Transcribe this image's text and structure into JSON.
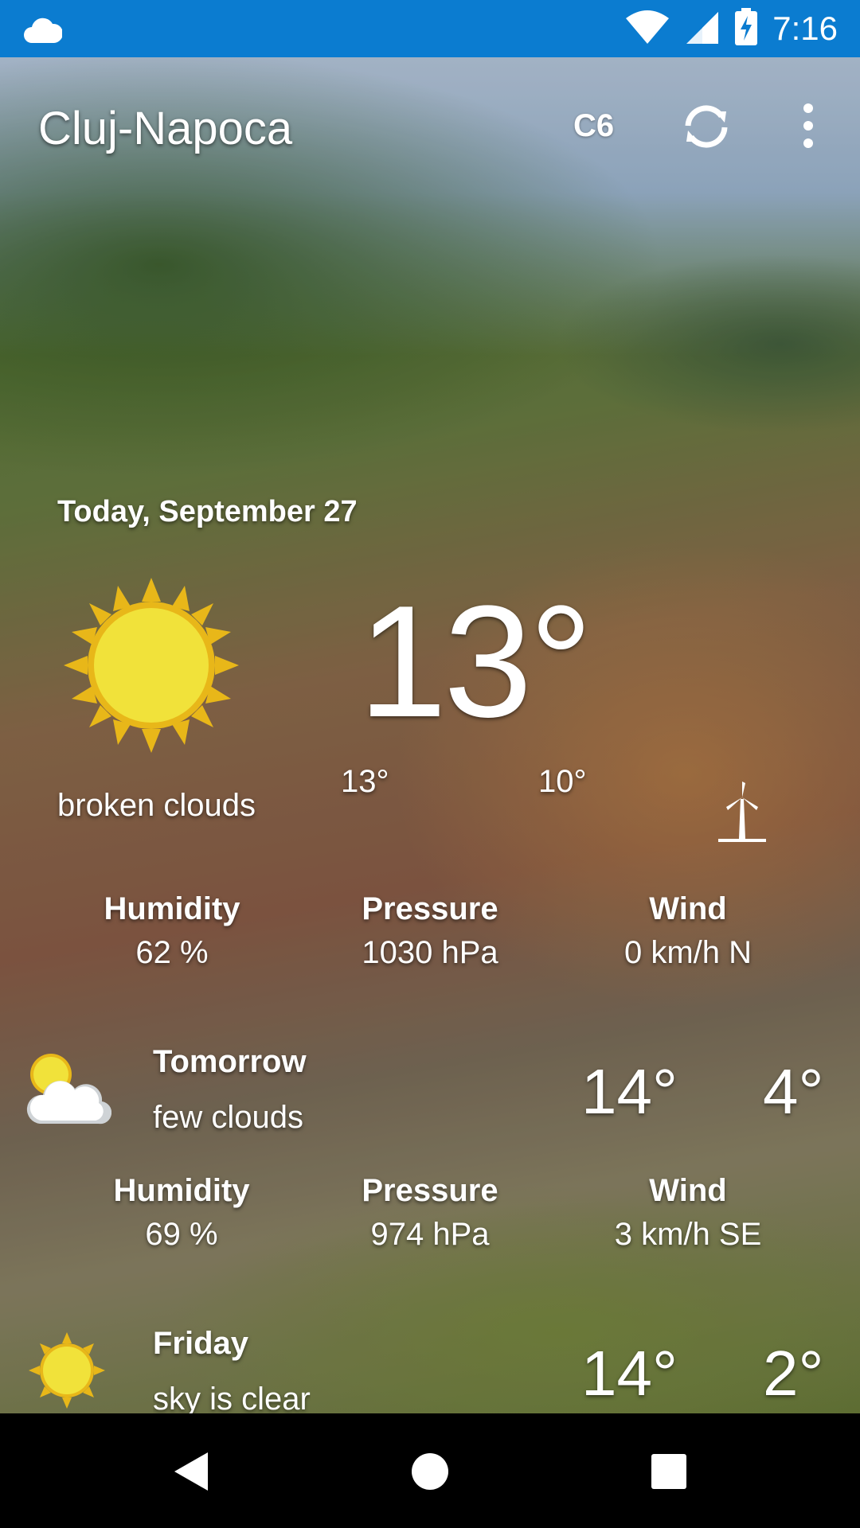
{
  "status_bar": {
    "time": "7:16",
    "notification_icon": "cloud-icon",
    "icons": [
      "wifi-icon",
      "signal-icon",
      "battery-charging-icon"
    ]
  },
  "toolbar": {
    "city": "Cluj-Napoca",
    "unit_label": "C6",
    "refresh_icon": "refresh-icon",
    "menu_icon": "more-vert-icon"
  },
  "today": {
    "date": "Today, September 27",
    "icon": "sun-icon",
    "temperature": "13°",
    "high": "13°",
    "low": "10°",
    "description": "broken clouds",
    "wind_icon": "windmill-icon",
    "metrics": [
      {
        "label": "Humidity",
        "value": "62 %"
      },
      {
        "label": "Pressure",
        "value": "1030 hPa"
      },
      {
        "label": "Wind",
        "value": "0 km/h N"
      }
    ]
  },
  "forecast": [
    {
      "day": "Tomorrow",
      "description": "few clouds",
      "icon": "sun-cloud-icon",
      "high": "14°",
      "low": "4°",
      "metrics": [
        {
          "label": "Humidity",
          "value": "69 %"
        },
        {
          "label": "Pressure",
          "value": "974 hPa"
        },
        {
          "label": "Wind",
          "value": "3 km/h SE"
        }
      ]
    },
    {
      "day": "Friday",
      "description": "sky is clear",
      "icon": "sun-icon",
      "high": "14°",
      "low": "2°"
    }
  ],
  "nav": {
    "back": "back-icon",
    "home": "home-icon",
    "recents": "recents-icon"
  },
  "colors": {
    "status_bar": "#0b7cd0",
    "nav_bar": "#000000",
    "sun": "#f1e23a",
    "sun_rays": "#e8b719"
  }
}
